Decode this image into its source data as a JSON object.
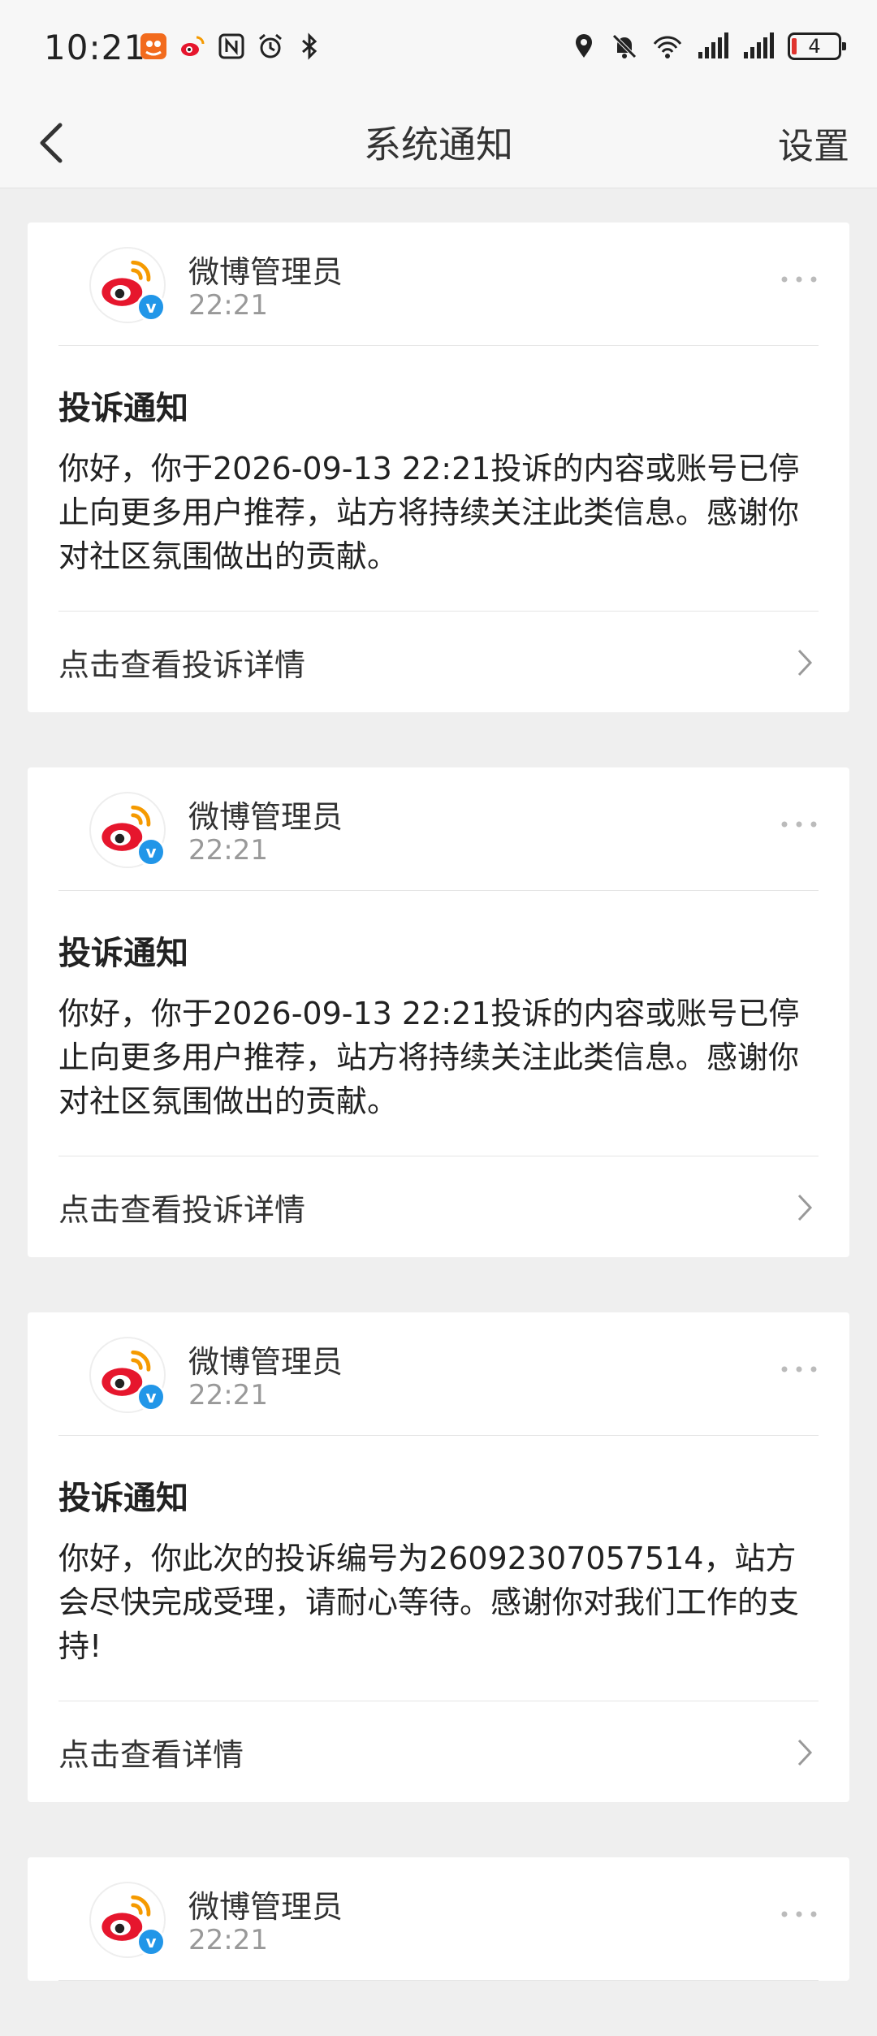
{
  "status_bar": {
    "time": "10:21",
    "battery": "4",
    "icons_left": [
      "taobao-icon",
      "weibo-icon",
      "nfc-icon",
      "alarm-icon",
      "bluetooth-icon"
    ],
    "icons_right": [
      "location-icon",
      "mute-icon",
      "wifi-icon",
      "signal-icon",
      "signal-icon",
      "battery-icon"
    ]
  },
  "nav": {
    "title": "系统通知",
    "settings": "设置"
  },
  "accent_color": "#2196e8",
  "notifications": [
    {
      "sender": "微博管理员",
      "time": "22:21",
      "title": "投诉通知",
      "text": "你好，你于2026-09-13 22:21投诉的内容或账号已停止向更多用户推荐，站方将持续关注此类信息。感谢你对社区氛围做出的贡献。",
      "link": "点击查看投诉详情"
    },
    {
      "sender": "微博管理员",
      "time": "22:21",
      "title": "投诉通知",
      "text": "你好，你于2026-09-13 22:21投诉的内容或账号已停止向更多用户推荐，站方将持续关注此类信息。感谢你对社区氛围做出的贡献。",
      "link": "点击查看投诉详情"
    },
    {
      "sender": "微博管理员",
      "time": "22:21",
      "title": "投诉通知",
      "text": "你好，你此次的投诉编号为26092307057514，站方会尽快完成受理，请耐心等待。感谢你对我们工作的支持!",
      "link": "点击查看详情"
    },
    {
      "sender": "微博管理员",
      "time": "22:21"
    }
  ]
}
